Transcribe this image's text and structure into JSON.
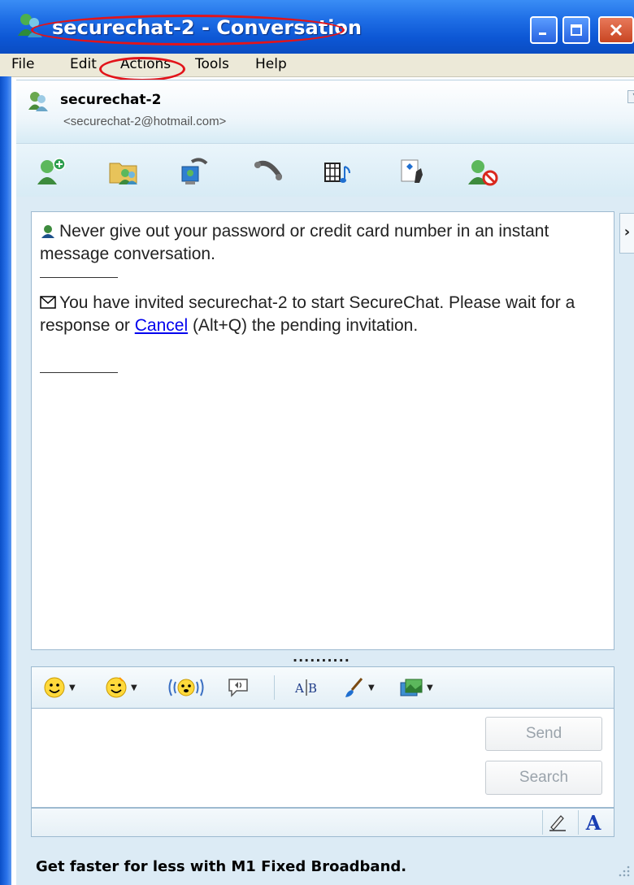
{
  "window": {
    "title": "securechat-2 - Conversation"
  },
  "menu": {
    "items": [
      {
        "label": "File"
      },
      {
        "label": "Edit"
      },
      {
        "label": "Actions"
      },
      {
        "label": "Tools"
      },
      {
        "label": "Help"
      }
    ]
  },
  "contact": {
    "name": "securechat-2",
    "email": "<securechat-2@hotmail.com>"
  },
  "toolbar": {
    "icons": [
      "invite-contact-icon",
      "share-files-icon",
      "video-call-icon",
      "phone-call-icon",
      "webcam-music-icon",
      "games-icon",
      "block-contact-icon"
    ]
  },
  "history": {
    "warning": "Never give out your password or credit card number in an instant message conversation.",
    "invite_before": "You have invited securechat-2 to start SecureChat. Please wait for a response or ",
    "cancel_link": "Cancel",
    "invite_after": " (Alt+Q) the pending invitation."
  },
  "grip": "..........",
  "input_toolbar": {
    "icons": [
      "emoticon-icon",
      "wink-icon",
      "nudge-icon",
      "voice-clip-icon",
      "font-icon",
      "background-icon",
      "image-icon"
    ]
  },
  "buttons": {
    "send": "Send",
    "search": "Search"
  },
  "format": {
    "font_label": "A"
  },
  "ad": {
    "text": "Get faster for less with M1 Fixed Broadband."
  },
  "colors": {
    "title_bar": "#0d57d5",
    "highlight_oval": "#e2141a",
    "link": "#0000ee"
  }
}
